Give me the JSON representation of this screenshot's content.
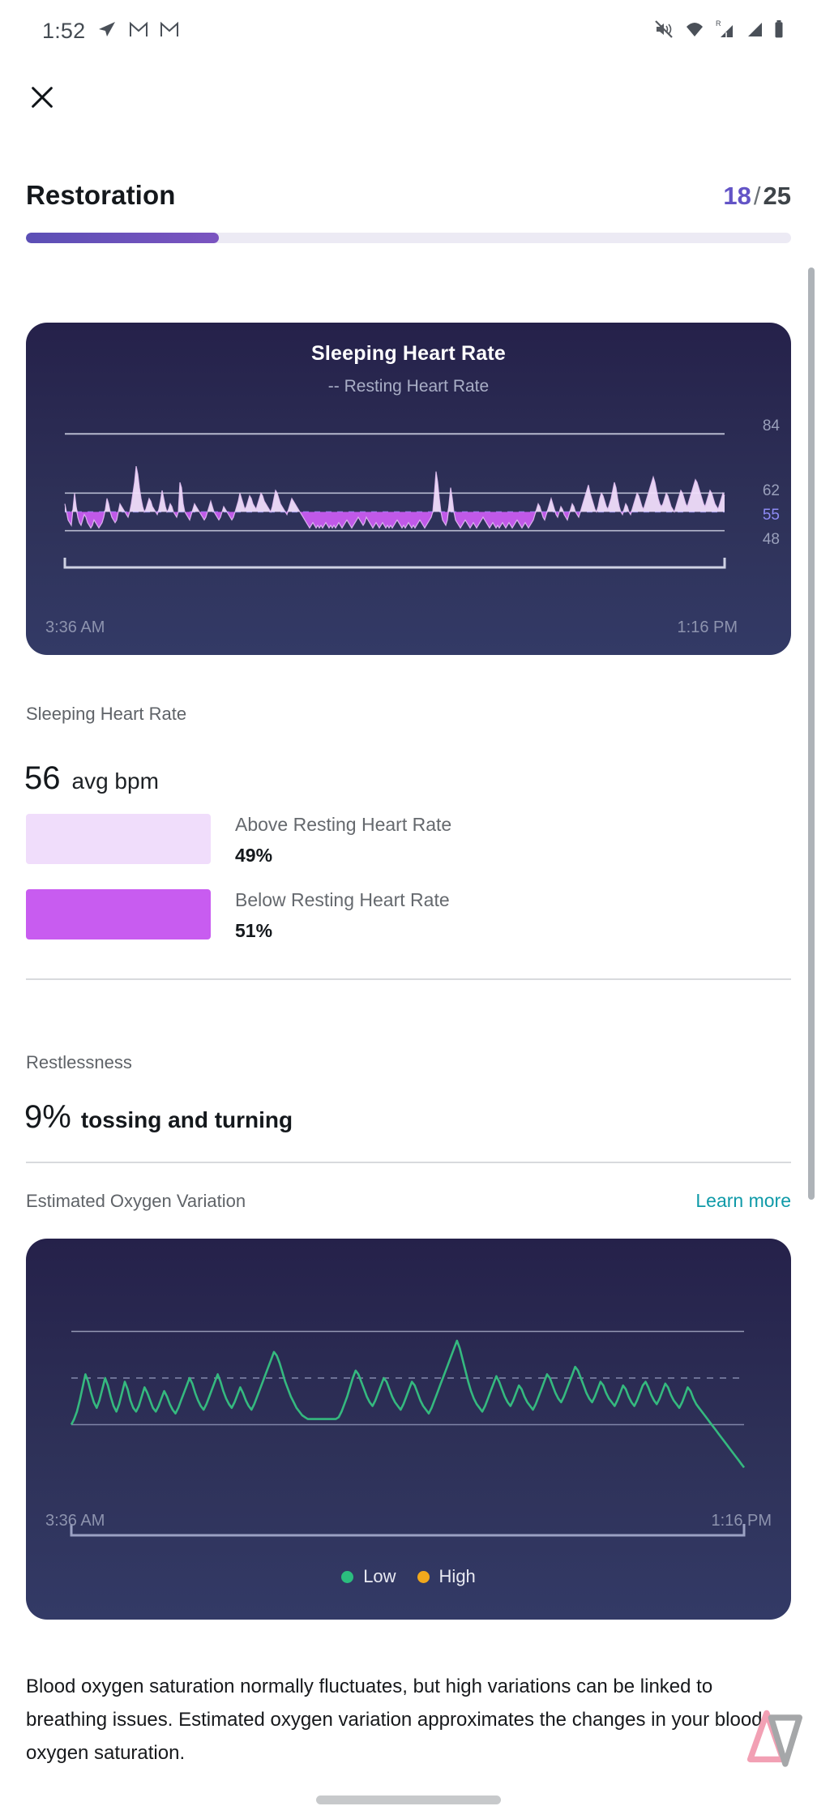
{
  "status_bar": {
    "time": "1:52",
    "left_icons": [
      "telegram-icon",
      "gmail-icon",
      "gmail-icon"
    ],
    "right_icons": [
      "mute-icon",
      "wifi-icon",
      "roaming-signal-icon",
      "signal-icon",
      "battery-icon"
    ],
    "roaming_badge": "R"
  },
  "header": {
    "close_icon": "close-icon",
    "title": "Restoration",
    "counter_current": "18",
    "counter_sep": "/",
    "counter_total": "25",
    "progress_percent": 25.2,
    "accent_color": "#6354c6",
    "track_color": "#eceaf4"
  },
  "hr_card": {
    "title": "Sleeping Heart Rate",
    "subtitle": "-- Resting Heart Rate",
    "axis": {
      "top": "84",
      "upper": "62",
      "resting": "55",
      "lower": "48"
    },
    "time_start": "3:36 AM",
    "time_end": "1:16 PM"
  },
  "hr_summary": {
    "label": "Sleeping Heart Rate",
    "value": "56",
    "unit": "avg bpm",
    "legend": [
      {
        "name": "Above Resting Heart Rate",
        "value": "49%",
        "color": "#f0ddfb"
      },
      {
        "name": "Below Resting Heart Rate",
        "value": "51%",
        "color": "#c85cf0"
      }
    ]
  },
  "restlessness": {
    "label": "Restlessness",
    "value": "9%",
    "caption": "tossing and turning"
  },
  "oxygen": {
    "label": "Estimated Oxygen Variation",
    "learn_more": "Learn more",
    "time_start": "3:36 AM",
    "time_end": "1:16 PM",
    "legend": [
      {
        "label": "Low",
        "color": "#2bbd7e"
      },
      {
        "label": "High",
        "color": "#f1a81c"
      }
    ],
    "description": "Blood oxygen saturation normally fluctuates, but high variations can be linked to breathing issues. Estimated oxygen variation approximates the changes in your blood oxygen saturation."
  },
  "chart_data": [
    {
      "type": "line",
      "title": "Sleeping Heart Rate",
      "subtitle": "-- Resting Heart Rate",
      "xlabel": "",
      "ylabel": "bpm",
      "ylim": [
        44,
        88
      ],
      "x_start_label": "3:36 AM",
      "x_end_label": "1:16 PM",
      "gridlines": [
        84,
        62,
        48
      ],
      "reference_line": {
        "value": 55,
        "label": "55",
        "style": "dashed"
      },
      "series": [
        {
          "name": "Sleeping Heart Rate",
          "color_above": "#f0ddfb",
          "color_below": "#c85cf0",
          "values": [
            58,
            55,
            52,
            51,
            50,
            56,
            62,
            57,
            53,
            51,
            50,
            52,
            54,
            53,
            51,
            50,
            49,
            50,
            52,
            51,
            50,
            49,
            50,
            51,
            53,
            56,
            60,
            58,
            55,
            53,
            52,
            51,
            52,
            55,
            58,
            57,
            56,
            55,
            54,
            53,
            55,
            58,
            62,
            66,
            72,
            69,
            64,
            60,
            57,
            55,
            56,
            58,
            60,
            59,
            57,
            56,
            55,
            54,
            56,
            59,
            63,
            60,
            57,
            55,
            56,
            58,
            57,
            55,
            54,
            53,
            55,
            66,
            64,
            58,
            55,
            54,
            53,
            52,
            54,
            56,
            58,
            57,
            56,
            55,
            54,
            53,
            52,
            53,
            55,
            57,
            59,
            57,
            55,
            54,
            53,
            52,
            53,
            55,
            57,
            56,
            55,
            54,
            53,
            52,
            53,
            55,
            57,
            59,
            62,
            60,
            58,
            56,
            57,
            59,
            61,
            60,
            58,
            57,
            56,
            58,
            60,
            62,
            61,
            59,
            58,
            57,
            56,
            55,
            57,
            60,
            63,
            62,
            60,
            58,
            57,
            56,
            55,
            54,
            56,
            58,
            60,
            59,
            58,
            57,
            56,
            55,
            54,
            53,
            52,
            51,
            50,
            49,
            50,
            51,
            50,
            49,
            50,
            49,
            50,
            49,
            50,
            51,
            50,
            49,
            50,
            49,
            50,
            49,
            50,
            51,
            50,
            49,
            50,
            51,
            52,
            51,
            50,
            49,
            50,
            51,
            52,
            53,
            52,
            51,
            50,
            51,
            53,
            52,
            51,
            50,
            49,
            50,
            51,
            50,
            49,
            50,
            51,
            50,
            49,
            50,
            49,
            50,
            49,
            50,
            51,
            52,
            51,
            50,
            49,
            50,
            49,
            50,
            51,
            50,
            49,
            50,
            49,
            50,
            51,
            52,
            51,
            50,
            49,
            50,
            51,
            52,
            53,
            55,
            62,
            70,
            66,
            60,
            55,
            52,
            51,
            50,
            52,
            58,
            64,
            60,
            55,
            52,
            51,
            50,
            49,
            50,
            51,
            52,
            51,
            50,
            49,
            50,
            51,
            50,
            49,
            50,
            51,
            52,
            53,
            52,
            51,
            50,
            49,
            50,
            51,
            50,
            49,
            50,
            49,
            50,
            51,
            50,
            49,
            50,
            51,
            50,
            49,
            50,
            51,
            52,
            51,
            50,
            49,
            50,
            51,
            50,
            49,
            50,
            51,
            52,
            54,
            56,
            58,
            57,
            55,
            53,
            52,
            54,
            56,
            58,
            60,
            58,
            56,
            54,
            53,
            55,
            57,
            56,
            54,
            53,
            52,
            54,
            56,
            58,
            57,
            55,
            54,
            53,
            55,
            57,
            59,
            61,
            63,
            65,
            62,
            60,
            58,
            56,
            55,
            57,
            60,
            62,
            61,
            59,
            57,
            56,
            58,
            60,
            63,
            66,
            64,
            60,
            57,
            55,
            54,
            56,
            58,
            57,
            55,
            54,
            56,
            58,
            60,
            62,
            61,
            59,
            57,
            56,
            58,
            60,
            62,
            64,
            66,
            68,
            66,
            63,
            60,
            58,
            57,
            58,
            60,
            62,
            61,
            59,
            57,
            56,
            55,
            57,
            59,
            61,
            63,
            62,
            60,
            58,
            57,
            59,
            61,
            63,
            65,
            67,
            66,
            64,
            62,
            60,
            58,
            57,
            59,
            61,
            63,
            62,
            60,
            58,
            57,
            56,
            58,
            60,
            62,
            61
          ]
        }
      ]
    },
    {
      "type": "line",
      "title": "Estimated Oxygen Variation",
      "xlabel": "",
      "ylabel": "variation",
      "ylim": [
        0,
        100
      ],
      "x_start_label": "3:36 AM",
      "x_end_label": "1:16 PM",
      "gridlines": [
        85,
        60,
        35
      ],
      "legend": [
        "Low",
        "High"
      ],
      "series": [
        {
          "name": "Estimated Oxygen Variation",
          "color": "#35b97f",
          "values": [
            35,
            38,
            42,
            48,
            55,
            62,
            58,
            52,
            47,
            44,
            48,
            54,
            60,
            56,
            50,
            45,
            42,
            46,
            52,
            58,
            54,
            48,
            44,
            42,
            45,
            50,
            55,
            52,
            48,
            44,
            42,
            45,
            49,
            53,
            50,
            46,
            43,
            41,
            44,
            48,
            52,
            56,
            60,
            57,
            52,
            48,
            45,
            43,
            46,
            50,
            54,
            58,
            62,
            58,
            53,
            49,
            46,
            44,
            47,
            51,
            55,
            52,
            48,
            45,
            43,
            46,
            50,
            54,
            58,
            62,
            66,
            70,
            74,
            72,
            68,
            63,
            58,
            54,
            50,
            47,
            44,
            42,
            40,
            39,
            38,
            38,
            38,
            38,
            38,
            38,
            38,
            38,
            38,
            38,
            38,
            39,
            42,
            46,
            50,
            55,
            60,
            64,
            62,
            58,
            54,
            50,
            47,
            45,
            48,
            52,
            56,
            60,
            58,
            54,
            50,
            47,
            45,
            43,
            46,
            50,
            54,
            58,
            56,
            52,
            48,
            45,
            43,
            41,
            44,
            48,
            52,
            56,
            60,
            64,
            68,
            72,
            76,
            80,
            76,
            70,
            64,
            58,
            53,
            49,
            46,
            44,
            42,
            45,
            49,
            53,
            57,
            61,
            58,
            54,
            50,
            47,
            45,
            48,
            52,
            56,
            54,
            50,
            47,
            45,
            43,
            46,
            50,
            54,
            58,
            62,
            60,
            56,
            52,
            49,
            47,
            50,
            54,
            58,
            62,
            66,
            64,
            60,
            56,
            52,
            49,
            47,
            50,
            54,
            58,
            56,
            52,
            49,
            47,
            45,
            48,
            52,
            56,
            54,
            50,
            47,
            45,
            48,
            52,
            56,
            58,
            55,
            51,
            48,
            46,
            49,
            53,
            57,
            55,
            51,
            48,
            46,
            44,
            47,
            51,
            55,
            53,
            49,
            46,
            44,
            42,
            40,
            38,
            36,
            34,
            32,
            30,
            28,
            26,
            24,
            22,
            20,
            18,
            16,
            14,
            12
          ]
        }
      ]
    }
  ]
}
